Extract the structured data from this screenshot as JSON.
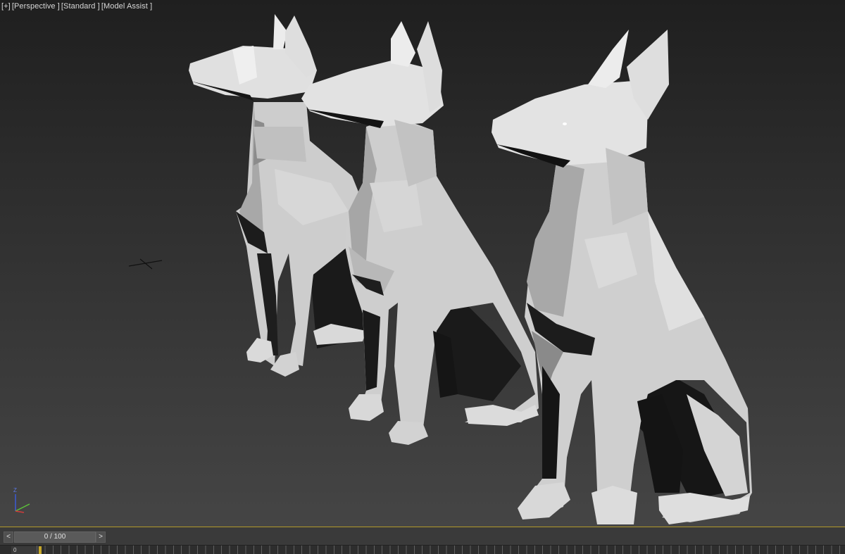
{
  "viewport": {
    "label_plus": "[+]",
    "label_view": "[Perspective ]",
    "label_shading": "[Standard ]",
    "label_mode": "[Model Assist ]",
    "axis_z": "Z"
  },
  "timeline": {
    "prev": "<",
    "next": ">",
    "slider_text": "0 / 100",
    "current_frame": 0,
    "total_frames": 100,
    "frame_label": "0"
  }
}
